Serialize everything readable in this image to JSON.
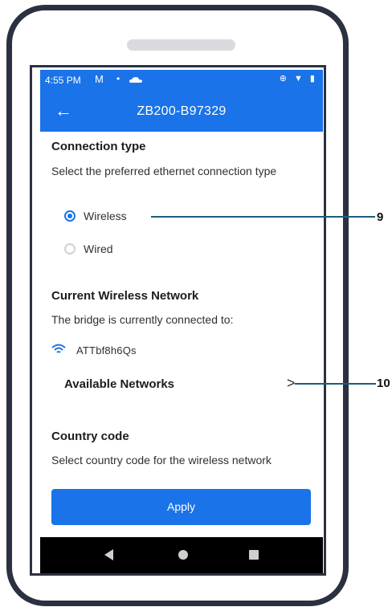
{
  "status_bar": {
    "time": "4:55 PM",
    "gmail_glyph": "M",
    "dot_glyph": "•",
    "right_icons": "⊕ ▼ ▮"
  },
  "app_bar": {
    "back_glyph": "←",
    "title": "ZB200-B97329"
  },
  "connection_type": {
    "title": "Connection type",
    "description": "Select the preferred ethernet connection type",
    "options": [
      {
        "label": "Wireless",
        "selected": true
      },
      {
        "label": "Wired",
        "selected": false
      }
    ]
  },
  "current_network": {
    "title": "Current Wireless Network",
    "description": "The bridge is currently connected to:",
    "ssid": "ATTbf8h6Qs"
  },
  "available_networks": {
    "label": "Available Networks",
    "chevron_glyph": ">"
  },
  "country_code": {
    "title": "Country code",
    "description": "Select country code for the wireless network"
  },
  "apply_button": {
    "label": "Apply"
  },
  "callouts": {
    "nine": "9",
    "ten": "10"
  },
  "colors": {
    "accent": "#1a73e8",
    "frame": "#2b3140",
    "callout_line": "#1b5e7e"
  },
  "icons": [
    "back-arrow-icon",
    "wifi-icon",
    "chevron-right-icon",
    "nav-back-icon",
    "nav-home-icon",
    "nav-recent-icon"
  ]
}
